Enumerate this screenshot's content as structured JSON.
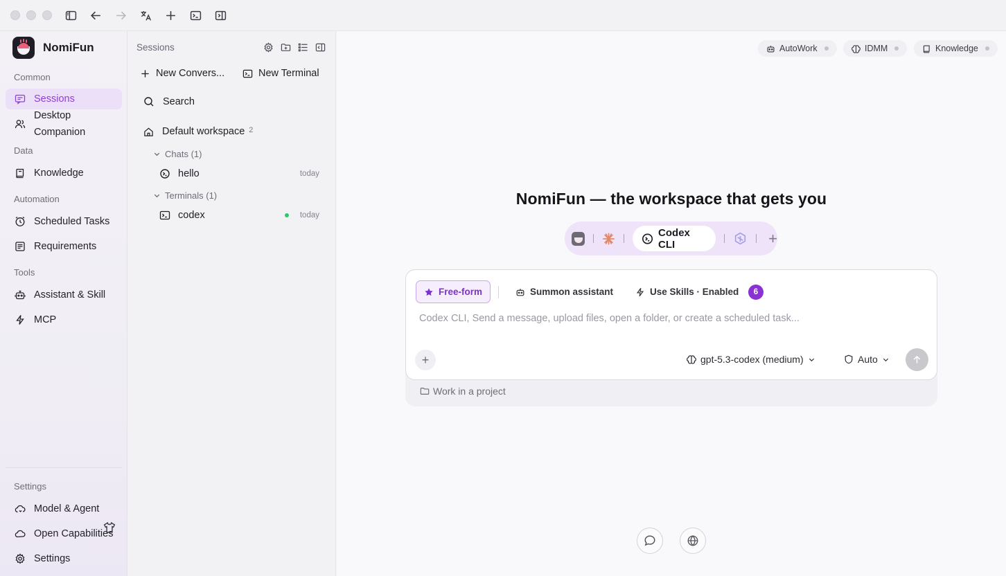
{
  "app": {
    "name": "NomiFun"
  },
  "sidebar": {
    "sections": {
      "common": "Common",
      "data": "Data",
      "automation": "Automation",
      "tools": "Tools",
      "settings": "Settings"
    },
    "items": {
      "sessions": "Sessions",
      "desktop_companion": "Desktop Companion",
      "knowledge": "Knowledge",
      "scheduled_tasks": "Scheduled Tasks",
      "requirements": "Requirements",
      "assistant_skill": "Assistant & Skill",
      "mcp": "MCP",
      "model_agent": "Model & Agent",
      "open_capabilities": "Open Capabilities",
      "settings": "Settings"
    }
  },
  "sessions_panel": {
    "title": "Sessions",
    "new_conversation": "New Convers...",
    "new_terminal": "New Terminal",
    "search": "Search",
    "workspace": {
      "name": "Default workspace",
      "count": "2"
    },
    "groups": {
      "chats": {
        "label": "Chats (1)",
        "items": [
          {
            "name": "hello",
            "when": "today"
          }
        ]
      },
      "terminals": {
        "label": "Terminals (1)",
        "items": [
          {
            "name": "codex",
            "when": "today"
          }
        ]
      }
    }
  },
  "main": {
    "top_pills": [
      "AutoWork",
      "IDMM",
      "Knowledge"
    ],
    "hero_title": "NomiFun — the workspace that gets you",
    "selected_agent": "Codex CLI",
    "modes": {
      "free_form": "Free-form",
      "summon": "Summon assistant",
      "skills": "Use Skills · Enabled",
      "skills_count": "6"
    },
    "placeholder": "Codex CLI, Send a message, upload files, open a folder, or create a scheduled task...",
    "model": "gpt-5.3-codex (medium)",
    "permission": "Auto",
    "project_link": "Work in a project"
  },
  "colors": {
    "accent": "#8a32d4",
    "active_nav_bg": "#ece0f8",
    "live_dot": "#2fc76b"
  }
}
